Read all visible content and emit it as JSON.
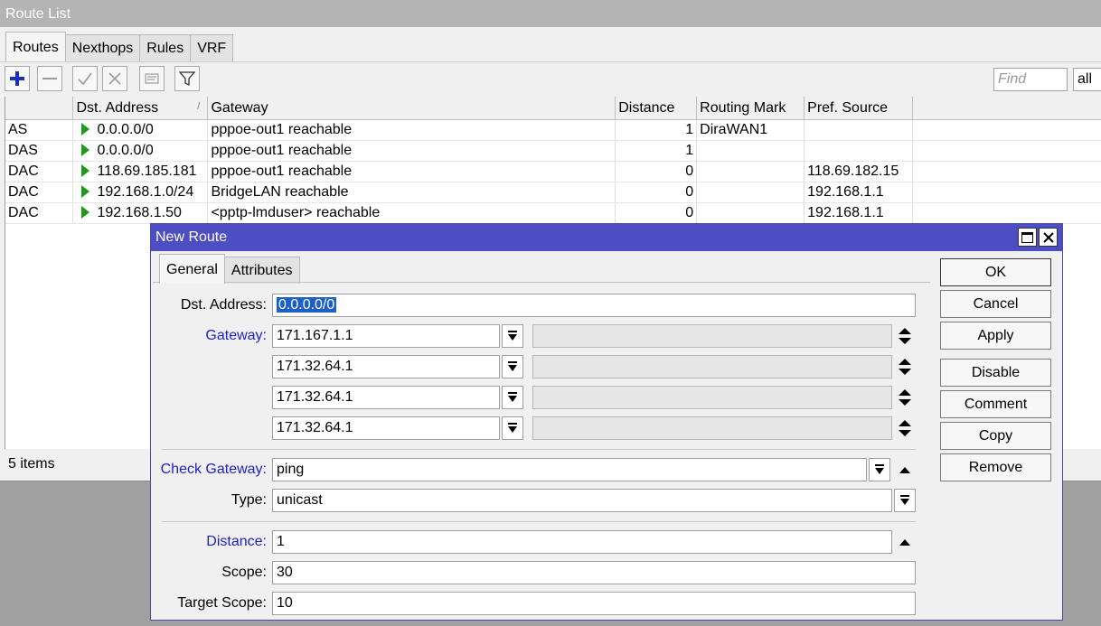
{
  "route_list": {
    "title": "Route List",
    "tabs": [
      "Routes",
      "Nexthops",
      "Rules",
      "VRF"
    ],
    "active_tab": "Routes",
    "toolbar": {
      "icons": [
        "add-icon",
        "remove-icon",
        "enable-icon",
        "disable-icon",
        "comment-icon",
        "filter-icon"
      ],
      "find_placeholder": "Find",
      "filter_value": "all"
    },
    "columns": [
      "",
      "Dst. Address",
      "Gateway",
      "Distance",
      "Routing Mark",
      "Pref. Source"
    ],
    "rows": [
      {
        "flags": "AS",
        "dst": "0.0.0.0/0",
        "gateway": "pppoe-out1 reachable",
        "distance": "1",
        "mark": "DiraWAN1",
        "pref": ""
      },
      {
        "flags": "DAS",
        "dst": "0.0.0.0/0",
        "gateway": "pppoe-out1 reachable",
        "distance": "1",
        "mark": "",
        "pref": ""
      },
      {
        "flags": "DAC",
        "dst": "118.69.185.181",
        "gateway": "pppoe-out1 reachable",
        "distance": "0",
        "mark": "",
        "pref": "118.69.182.15"
      },
      {
        "flags": "DAC",
        "dst": "192.168.1.0/24",
        "gateway": "BridgeLAN reachable",
        "distance": "0",
        "mark": "",
        "pref": "192.168.1.1"
      },
      {
        "flags": "DAC",
        "dst": "192.168.1.50",
        "gateway": "<pptp-lmduser> reachable",
        "distance": "0",
        "mark": "",
        "pref": "192.168.1.1"
      }
    ],
    "status": "5 items"
  },
  "dialog": {
    "title": "New Route",
    "tabs": [
      "General",
      "Attributes"
    ],
    "active_tab": "General",
    "labels": {
      "dst": "Dst. Address:",
      "gateway": "Gateway:",
      "check_gateway": "Check Gateway:",
      "type": "Type:",
      "distance": "Distance:",
      "scope": "Scope:",
      "target_scope": "Target Scope:"
    },
    "values": {
      "dst": "0.0.0.0/0",
      "gateways": [
        "171.167.1.1",
        "171.32.64.1",
        "171.32.64.1",
        "171.32.64.1"
      ],
      "check_gateway": "ping",
      "type": "unicast",
      "distance": "1",
      "scope": "30",
      "target_scope": "10"
    },
    "buttons": [
      "OK",
      "Cancel",
      "Apply",
      "Disable",
      "Comment",
      "Copy",
      "Remove"
    ]
  }
}
